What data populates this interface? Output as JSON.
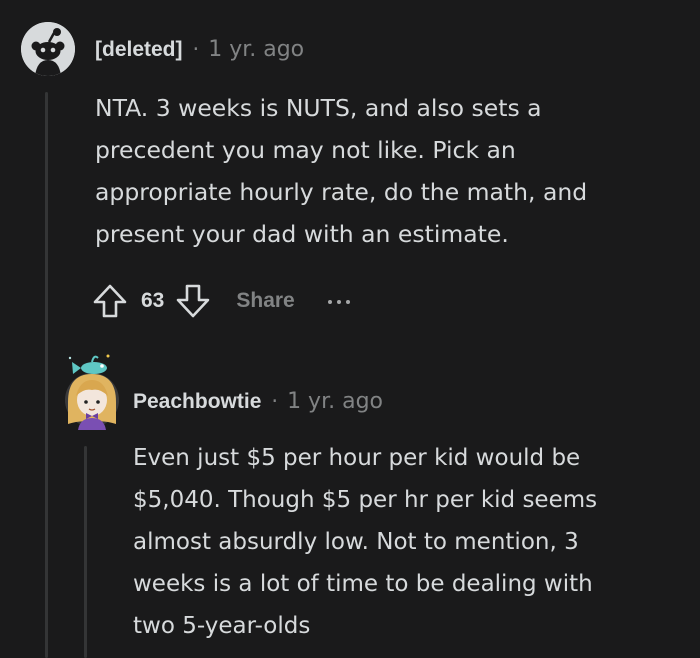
{
  "comments": [
    {
      "author": "[deleted]",
      "separator": "·",
      "time": "1 yr. ago",
      "avatar_icon": "snoo-avatar-icon",
      "body_lines": [
        "NTA. 3 weeks is NUTS, and also sets a",
        "precedent you may not like. Pick an",
        "appropriate hourly rate, do the math, and",
        "present your dad with an estimate."
      ],
      "score": "63",
      "share_label": "Share",
      "icons": [
        "upvote-arrow-icon",
        "downvote-arrow-icon",
        "more-options-icon"
      ]
    },
    {
      "author": "Peachbowtie",
      "separator": "·",
      "time": "1 yr. ago",
      "avatar_icon": "custom-avatar-icon",
      "body_lines": [
        "Even just $5 per hour per kid would be",
        "$5,040. Though $5 per hr per kid seems",
        "almost absurdly low. Not to mention, 3",
        "weeks is a lot of time to be dealing with",
        "two 5-year-olds"
      ]
    }
  ],
  "colors": {
    "background": "#1a1a1b",
    "text": "#d7dadc",
    "muted": "#818384",
    "thread_line": "#343536"
  }
}
